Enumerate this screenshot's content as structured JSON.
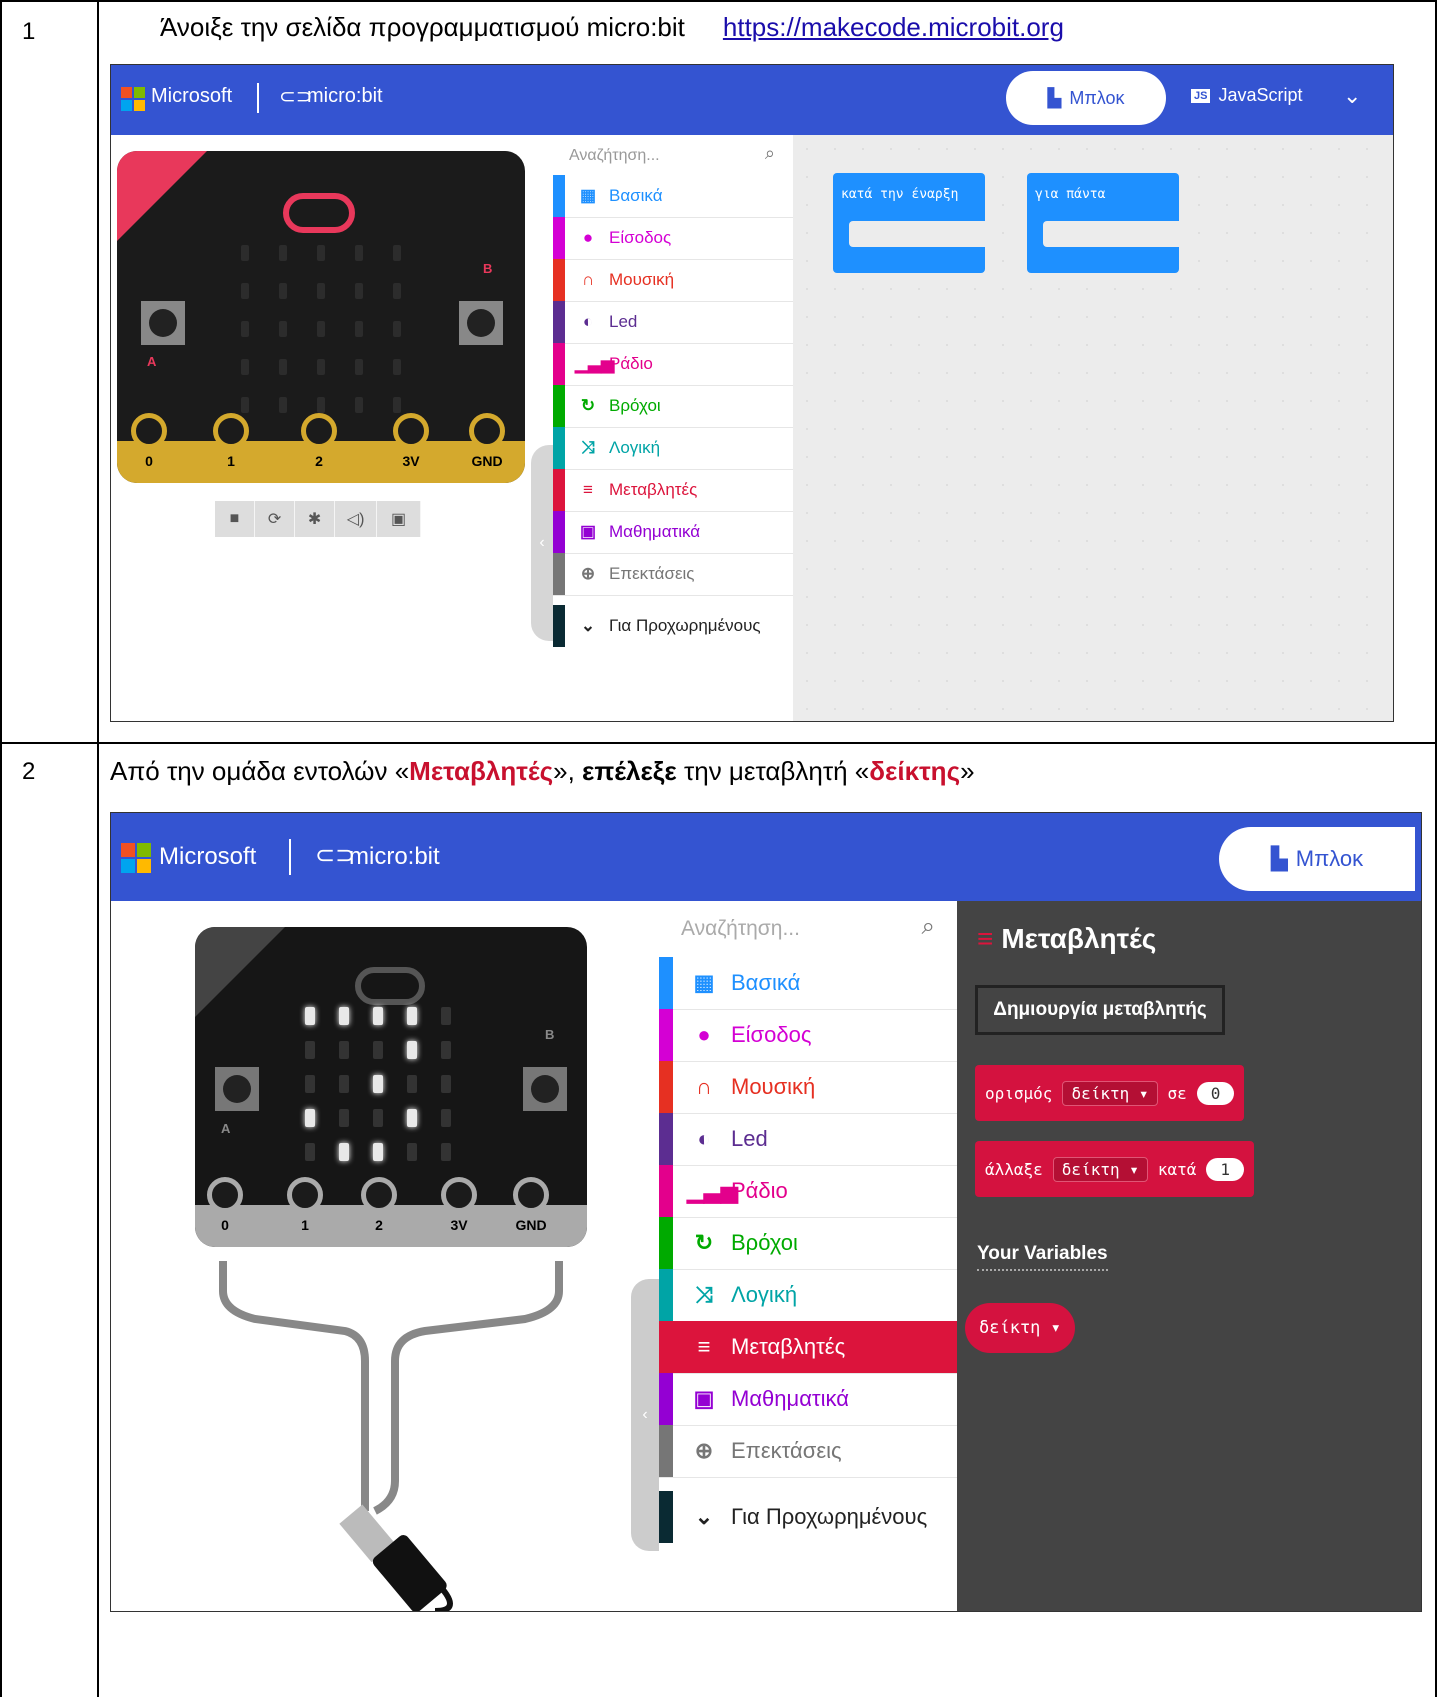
{
  "rows": [
    {
      "number": "1",
      "instruction_prefix": "Άνοιξε την σελίδα προγραμματισμού micro:bit",
      "link": "https://makecode.microbit.org"
    },
    {
      "number": "2",
      "part1": "Από την ομάδα εντολών «",
      "part2": "Μεταβλητές",
      "part3": "», ",
      "part4": "επέλεξε",
      "part5": " την μεταβλητή «",
      "part6": "δείκτης",
      "part7": "»"
    }
  ],
  "app": {
    "microsoft": "Microsoft",
    "microbit": "micro:bit",
    "blocks_tab": "Μπλοκ",
    "js_tab": "JavaScript",
    "search_placeholder": "Αναζήτηση...",
    "pins": [
      "0",
      "1",
      "2",
      "3V",
      "GND"
    ],
    "button_a": "A",
    "button_b": "B",
    "categories": [
      {
        "label": "Βασικά",
        "color": "#1e90ff",
        "icon": "grid-icon",
        "glyph": "▦"
      },
      {
        "label": "Είσοδος",
        "color": "#d400d4",
        "icon": "input-icon",
        "glyph": "●"
      },
      {
        "label": "Μουσική",
        "color": "#e63022",
        "icon": "headphones-icon",
        "glyph": "∩"
      },
      {
        "label": "Led",
        "color": "#5c2d91",
        "icon": "toggle-icon",
        "glyph": "◐"
      },
      {
        "label": "Ράδιο",
        "color": "#e3008c",
        "icon": "signal-icon",
        "glyph": "▁▃▅"
      },
      {
        "label": "Βρόχοι",
        "color": "#00aa00",
        "icon": "loop-icon",
        "glyph": "↻"
      },
      {
        "label": "Λογική",
        "color": "#00a4a6",
        "icon": "shuffle-icon",
        "glyph": "⤨"
      },
      {
        "label": "Μεταβλητές",
        "color": "#dc143c",
        "icon": "list-icon",
        "glyph": "≡"
      },
      {
        "label": "Μαθηματικά",
        "color": "#9400d3",
        "icon": "calculator-icon",
        "glyph": "▣"
      },
      {
        "label": "Επεκτάσεις",
        "color": "#767676",
        "icon": "plus-circle-icon",
        "glyph": "⊕"
      }
    ],
    "advanced": "Για Προχωρημένους",
    "on_start": "κατά την έναρξη",
    "forever": "για πάντα",
    "flyout": {
      "title": "Μεταβλητές",
      "create_button": "Δημιουργία μεταβλητής",
      "set_label": "ορισμός",
      "set_var": "δείκτη ▾",
      "set_to": "σε",
      "set_value": "0",
      "change_label": "άλλαξε",
      "change_var": "δείκτη ▾",
      "change_by": "κατά",
      "change_value": "1",
      "your_variables": "Your Variables",
      "variable_chip": "δείκτη ▾"
    }
  }
}
